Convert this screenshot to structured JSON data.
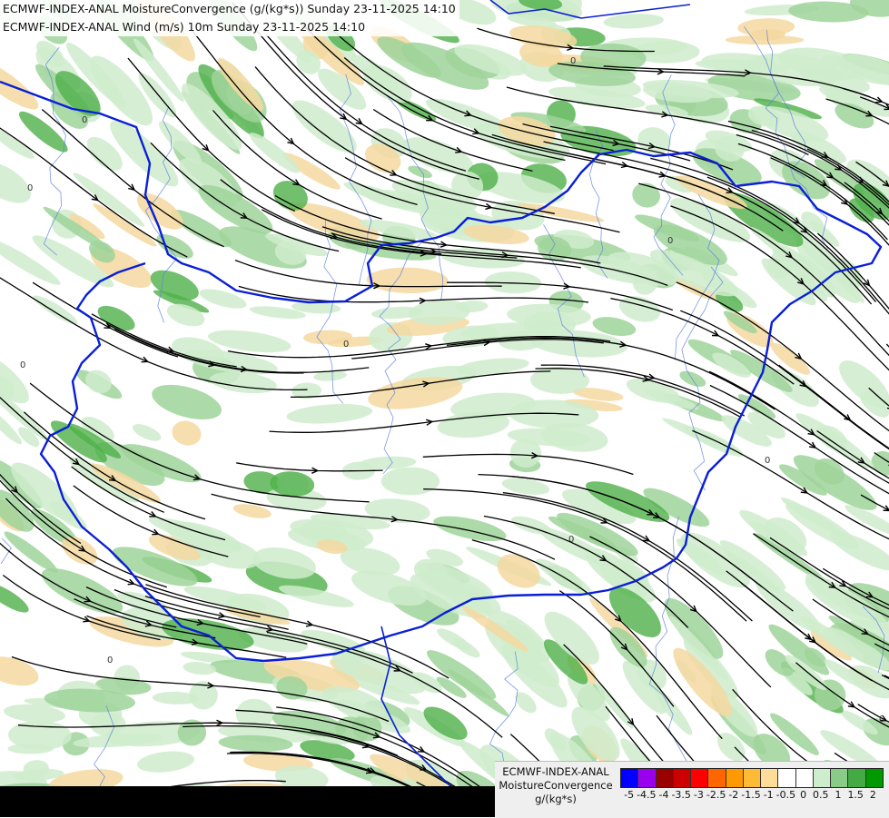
{
  "title_lines": [
    "ECMWF-INDEX-ANAL MoistureConvergence (g/(kg*s)) Sunday 23-11-2025 14:10",
    "ECMWF-INDEX-ANAL Wind (m/s) 10m Sunday 23-11-2025 14:10"
  ],
  "legend": {
    "label_lines": [
      "ECMWF-INDEX-ANAL",
      "MoistureConvergence",
      "g/(kg*s)"
    ],
    "ticks": [
      "-5",
      "-4.5",
      "-4",
      "-3.5",
      "-3",
      "-2.5",
      "-2",
      "-1.5",
      "-1",
      "-0.5",
      "0",
      "0.5",
      "1",
      "1.5",
      "2"
    ],
    "colors": [
      "#0000ff",
      "#9900ee",
      "#990000",
      "#cc0000",
      "#ff0000",
      "#ff6600",
      "#ff9900",
      "#ffbb33",
      "#ffdd99",
      "#ffffff",
      "#ffffff",
      "#cceecc",
      "#88cc88",
      "#44aa44",
      "#009900"
    ]
  },
  "colors": {
    "convergence_light": "#cfeccc",
    "convergence_mid": "#9fd49a",
    "convergence_strong": "#4fb04a",
    "divergence_light": "#f5d8a0",
    "border": "#0a1fd6",
    "river": "#5a7ee0",
    "streamline": "#000000"
  },
  "contour_label": "0"
}
